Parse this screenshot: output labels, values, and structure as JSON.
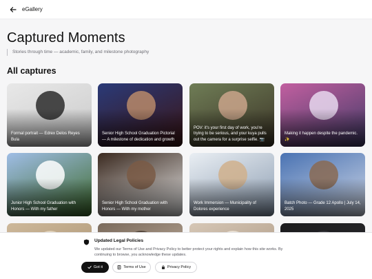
{
  "header": {
    "app_name": "eGallery",
    "back_icon": "arrow-left-icon"
  },
  "page": {
    "title": "Captured Moments",
    "subtitle": "Stories through time — academic, family, and milestone photography",
    "section_title": "All captures"
  },
  "gallery": [
    {
      "caption": "Formal portrait — Edrex Delos Reyes Bula",
      "colors": [
        "#e8e8e8",
        "#c9c9c9",
        "#2b2b2b"
      ]
    },
    {
      "caption": "Senior High School Graduation Pictorial — A milestone of dedication and growth",
      "colors": [
        "#2a3a78",
        "#3c1414",
        "#b98a6a"
      ]
    },
    {
      "caption": "POV: it’s your first day of work, you’re trying to be serious, and your kuya pulls out the camera for a surprise selfie. 📷",
      "colors": [
        "#6f7d56",
        "#3b3326",
        "#caa48b"
      ]
    },
    {
      "caption": "Making it happen despite the pandemic. ✨",
      "colors": [
        "#c25fa0",
        "#3f3a66",
        "#e7d8ee"
      ]
    },
    {
      "caption": "Junior High School Graduation with Honors — With my father",
      "colors": [
        "#9fbde6",
        "#3d6a2a",
        "#ffffff"
      ]
    },
    {
      "caption": "Senior High School Graduation with Honors — With my mother",
      "colors": [
        "#3b2a20",
        "#e9e9e9",
        "#7a5a45"
      ]
    },
    {
      "caption": "Work Immersion — Municipality of Dolores experience",
      "colors": [
        "#e9eef3",
        "#8a9bb0",
        "#d0b08c"
      ]
    },
    {
      "caption": "Batch Photo — Grade 12 Apollo | July 14, 2025",
      "colors": [
        "#4a73b3",
        "#cfd7e6",
        "#8a6a52"
      ]
    },
    {
      "caption": "",
      "colors": [
        "#cdb89a",
        "#a58d6c",
        "#e6d8c2"
      ]
    },
    {
      "caption": "",
      "colors": [
        "#7a6a5c",
        "#cbb9a6",
        "#4a3d33"
      ]
    },
    {
      "caption": "",
      "colors": [
        "#d6c7b6",
        "#a48f7a",
        "#efe6da"
      ]
    },
    {
      "caption": "",
      "colors": [
        "#1b1b1d",
        "#2c2c30",
        "#3a3a3e"
      ]
    }
  ],
  "consent": {
    "icon": "shield-icon",
    "title": "Updated Legal Policies",
    "text": "We updated our Terms of Use and Privacy Policy to better protect your rights and explain how this site works. By continuing to browse, you acknowledge these updates.",
    "accept_label": "Got it",
    "terms_label": "Terms of Use",
    "privacy_label": "Privacy Policy"
  }
}
